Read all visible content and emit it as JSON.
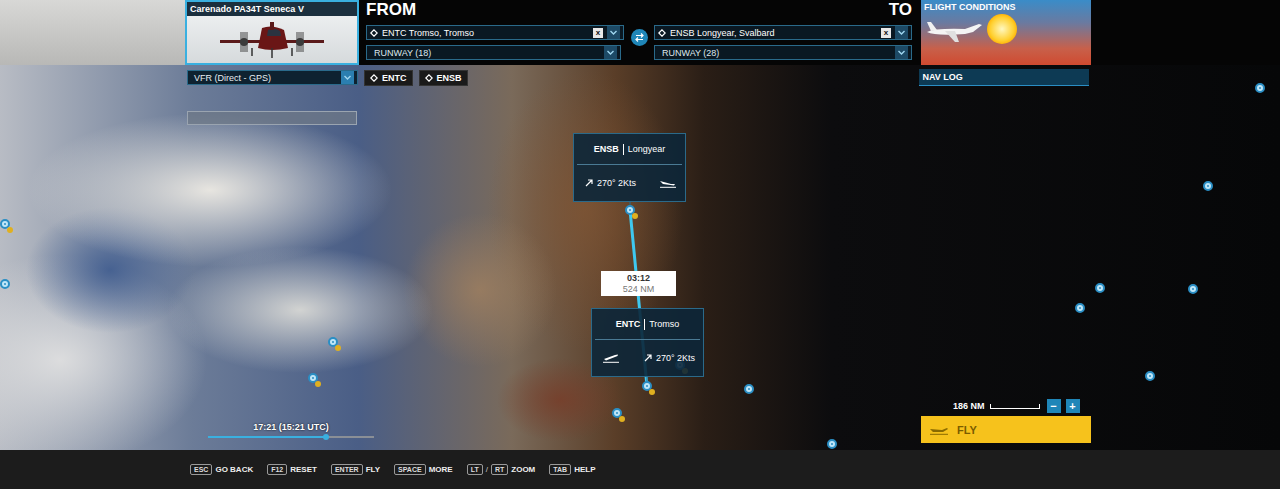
{
  "aircraft": {
    "name": "Carenado PA34T Seneca V"
  },
  "from": {
    "heading": "FROM",
    "airport": "ENTC Tromso, Tromso",
    "clear": "x",
    "runway": "RUNWAY (18)"
  },
  "to": {
    "heading": "TO",
    "airport": "ENSB Longyear, Svalbard",
    "clear": "x",
    "runway": "RUNWAY (28)"
  },
  "flight_conditions": {
    "title": "FLIGHT CONDITIONS"
  },
  "nav_log": {
    "label": "NAV LOG"
  },
  "flight_plan": {
    "type": "VFR (Direct - GPS)",
    "waypoints": [
      "ENTC",
      "ENSB"
    ]
  },
  "map": {
    "airports": [
      {
        "code": "ENSB",
        "name": "Longyear",
        "wind": "270° 2Kts",
        "kind": "arrival"
      },
      {
        "code": "ENTC",
        "name": "Tromso",
        "wind": "270° 2Kts",
        "kind": "departure"
      }
    ],
    "route": {
      "time": "03:12",
      "distance": "524 NM"
    },
    "scale": "186 NM",
    "zoom_out": "−",
    "zoom_in": "+"
  },
  "time_slider": {
    "label": "17:21 (15:21 UTC)",
    "level": 0.71
  },
  "fly_button": {
    "label": "FLY"
  },
  "shortcuts": [
    {
      "keys": [
        "ESC"
      ],
      "separator": "",
      "label": "GO BACK"
    },
    {
      "keys": [
        "F12"
      ],
      "separator": "",
      "label": "RESET"
    },
    {
      "keys": [
        "ENTER"
      ],
      "separator": "",
      "label": "FLY"
    },
    {
      "keys": [
        "SPACE"
      ],
      "separator": "",
      "label": "MORE"
    },
    {
      "keys": [
        "LT",
        "RT"
      ],
      "separator": "/",
      "label": "ZOOM"
    },
    {
      "keys": [
        "TAB"
      ],
      "separator": "",
      "label": "HELP"
    }
  ]
}
